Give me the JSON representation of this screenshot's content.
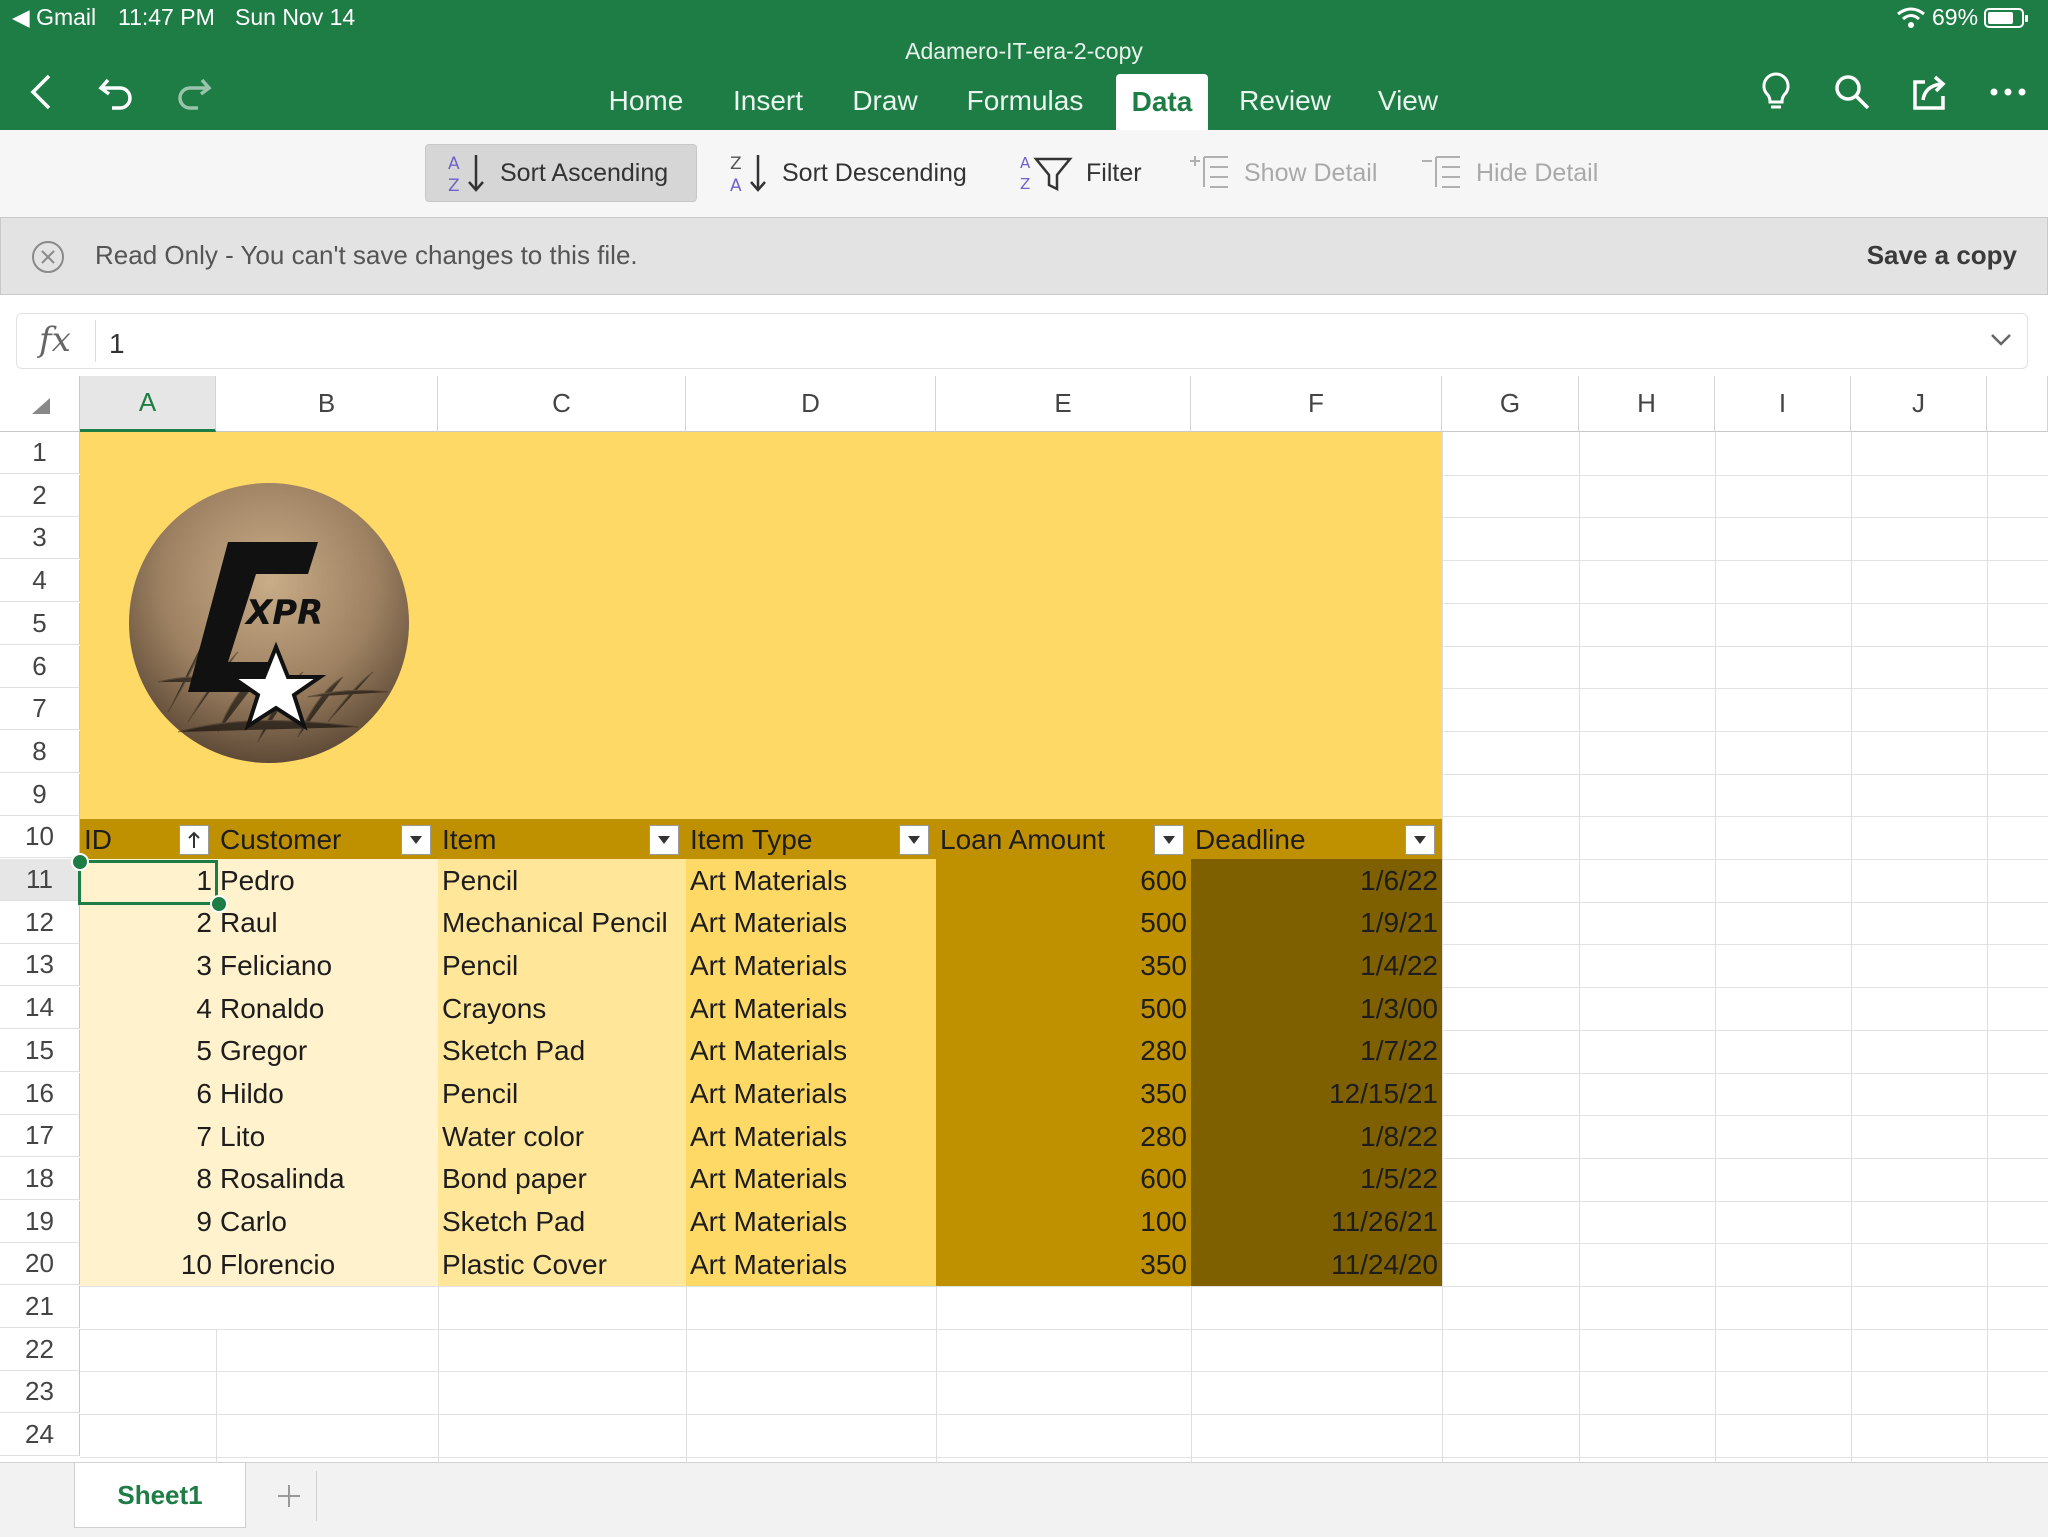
{
  "status_bar": {
    "back_app": "Gmail",
    "time": "11:47 PM",
    "date": "Sun Nov 14",
    "battery": "69%"
  },
  "app": {
    "document_title": "Adamero-IT-era-2-copy",
    "accent_color": "#1e7c45"
  },
  "tabs": [
    {
      "label": "Home"
    },
    {
      "label": "Insert"
    },
    {
      "label": "Draw"
    },
    {
      "label": "Formulas"
    },
    {
      "label": "Data",
      "active": true
    },
    {
      "label": "Review"
    },
    {
      "label": "View"
    }
  ],
  "ribbon": {
    "sort_ascending": "Sort Ascending",
    "sort_descending": "Sort Descending",
    "filter": "Filter",
    "show_detail": "Show Detail",
    "hide_detail": "Hide Detail"
  },
  "banner": {
    "message": "Read Only - You can't save changes to this file.",
    "action": "Save a copy"
  },
  "formula_bar": {
    "fx": "fx",
    "value": "1"
  },
  "columns": [
    "A",
    "B",
    "C",
    "D",
    "E",
    "F",
    "G",
    "H",
    "I",
    "J"
  ],
  "rows": [
    "1",
    "2",
    "3",
    "4",
    "5",
    "6",
    "7",
    "8",
    "9",
    "10",
    "11",
    "12",
    "13",
    "14",
    "15",
    "16",
    "17",
    "18",
    "19",
    "20",
    "21",
    "22",
    "23",
    "24"
  ],
  "table": {
    "headers": [
      "ID",
      "Customer",
      "Item",
      "Item Type",
      "Loan Amount",
      "Deadline"
    ],
    "rows": [
      [
        "1",
        "Pedro",
        "Pencil",
        "Art Materials",
        "600",
        "1/6/22"
      ],
      [
        "2",
        "Raul",
        "Mechanical Pencil",
        "Art Materials",
        "500",
        "1/9/21"
      ],
      [
        "3",
        "Feliciano",
        "Pencil",
        "Art Materials",
        "350",
        "1/4/22"
      ],
      [
        "4",
        "Ronaldo",
        "Crayons",
        "Art Materials",
        "500",
        "1/3/00"
      ],
      [
        "5",
        "Gregor",
        "Sketch Pad",
        "Art Materials",
        "280",
        "1/7/22"
      ],
      [
        "6",
        "Hildo",
        "Pencil",
        "Art Materials",
        "350",
        "12/15/21"
      ],
      [
        "7",
        "Lito",
        "Water color",
        "Art Materials",
        "280",
        "1/8/22"
      ],
      [
        "8",
        "Rosalinda",
        "Bond paper",
        "Art Materials",
        "600",
        "1/5/22"
      ],
      [
        "9",
        "Carlo",
        "Sketch Pad",
        "Art Materials",
        "100",
        "11/26/21"
      ],
      [
        "10",
        "Florencio",
        "Plastic Cover",
        "Art Materials",
        "350",
        "11/24/20"
      ]
    ]
  },
  "logo": {
    "text": "XPR"
  },
  "sheets": [
    {
      "label": "Sheet1"
    }
  ],
  "colors": {
    "banner_fill": "#ffd966",
    "header_fill": "#bf9000",
    "col_light": "#fff2cc",
    "col_mid": "#ffe699",
    "col_gold": "#ffd966",
    "col_dark": "#bf9000",
    "col_darkest": "#7f6000"
  }
}
